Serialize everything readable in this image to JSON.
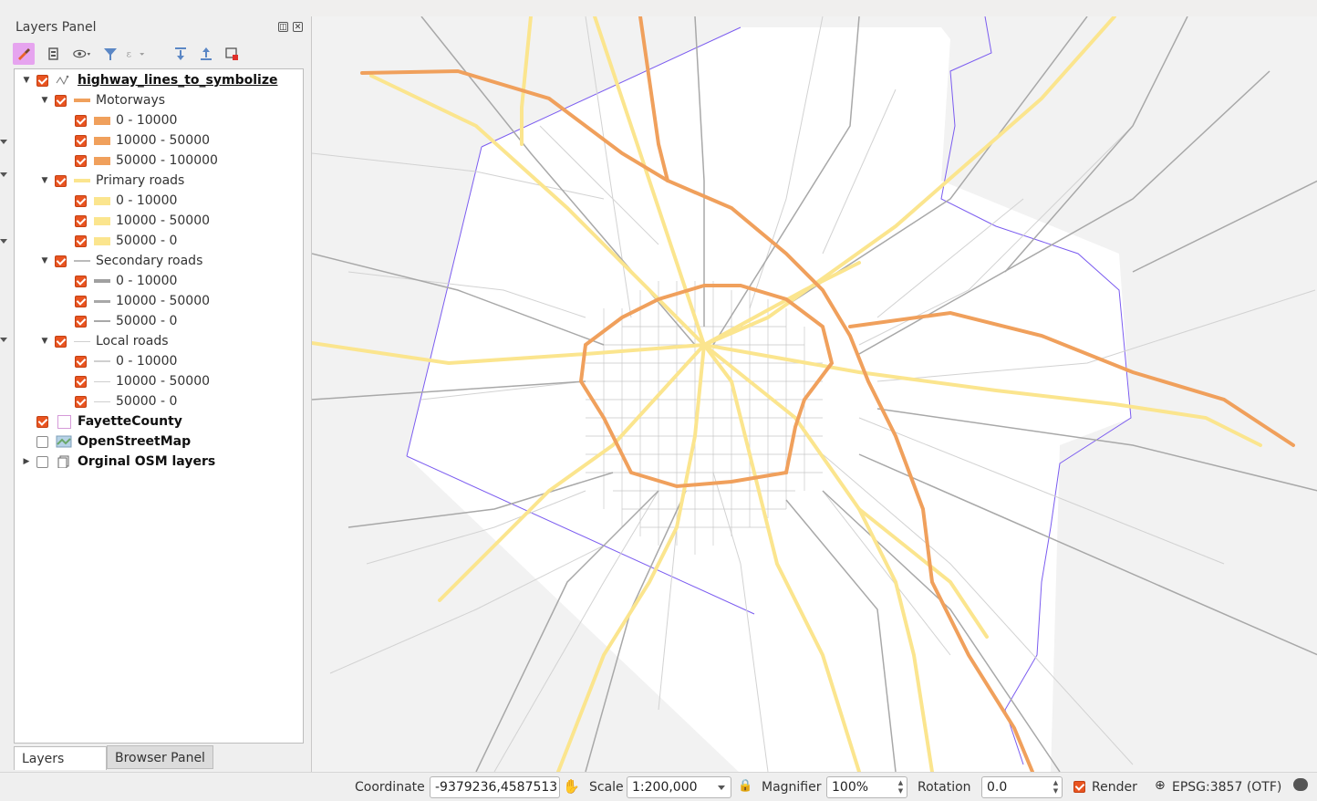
{
  "panel": {
    "title": "Layers Panel",
    "float_icon": "float-icon",
    "close_icon": "close-icon"
  },
  "toolbar": [
    {
      "name": "style-manager-icon"
    },
    {
      "name": "add-group-icon"
    },
    {
      "name": "visibility-eye-icon"
    },
    {
      "name": "filter-legend-icon"
    },
    {
      "name": "filter-expression-icon"
    },
    {
      "name": "expand-all-icon"
    },
    {
      "name": "collapse-all-icon"
    },
    {
      "name": "remove-layer-icon"
    }
  ],
  "layers": {
    "highway": {
      "label": "highway_lines_to_symbolize",
      "checked": true
    },
    "motorways": {
      "label": "Motorways",
      "color": "#f0a05c",
      "items": [
        "0 - 10000",
        "10000 - 50000",
        "50000 - 100000"
      ]
    },
    "primary": {
      "label": "Primary roads",
      "color": "#fbe58e",
      "items": [
        "0 - 10000",
        "10000 - 50000",
        "50000 - 0"
      ]
    },
    "secondary": {
      "label": "Secondary roads",
      "color": "#a8a8a8",
      "items": [
        "0 - 10000",
        "10000 - 50000",
        "50000 - 0"
      ]
    },
    "local": {
      "label": "Local roads",
      "color": "#cfcfcf",
      "items": [
        "0 - 10000",
        "10000 - 50000",
        "50000 - 0"
      ]
    },
    "fayette": {
      "label": "FayetteCounty",
      "checked": true
    },
    "osm": {
      "label": "OpenStreetMap",
      "checked": false
    },
    "orginal": {
      "label": "Orginal OSM layers",
      "checked": false
    }
  },
  "tabs": {
    "layers": "Layers Panel",
    "browser": "Browser Panel"
  },
  "status": {
    "coordinate_label": "Coordinate",
    "coordinate_value": "-9379236,4587513",
    "scale_label": "Scale",
    "scale_value": "1:200,000",
    "magnifier_label": "Magnifier",
    "magnifier_value": "100%",
    "rotation_label": "Rotation",
    "rotation_value": "0.0",
    "render_label": "Render",
    "render_checked": true,
    "crs_label": "EPSG:3857 (OTF)"
  },
  "colors": {
    "motorway": "#f0a05c",
    "primary": "#fbe58e",
    "secondary": "#a8a8a8",
    "local": "#d4d4d4",
    "county_boundary": "#7b5cf0",
    "checkbox": "#e95420"
  }
}
